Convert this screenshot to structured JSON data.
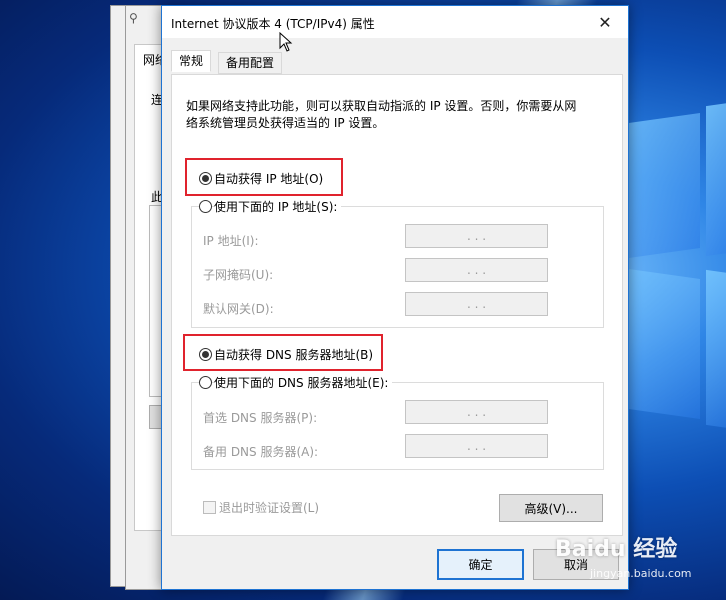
{
  "dialog": {
    "title": "Internet 协议版本 4 (TCP/IPv4) 属性",
    "tabs": [
      "常规",
      "备用配置"
    ],
    "description_line1": "如果网络支持此功能，则可以获取自动指派的 IP 设置。否则，你需要从网",
    "description_line2": "络系统管理员处获得适当的 IP 设置。",
    "ip": {
      "auto_label": "自动获得 IP 地址(O)",
      "manual_label": "使用下面的 IP 地址(S):",
      "fields": [
        {
          "label": "IP 地址(I):",
          "value": ".      .      ."
        },
        {
          "label": "子网掩码(U):",
          "value": ".      .      ."
        },
        {
          "label": "默认网关(D):",
          "value": ".      .      ."
        }
      ]
    },
    "dns": {
      "auto_label": "自动获得 DNS 服务器地址(B)",
      "manual_label": "使用下面的 DNS 服务器地址(E):",
      "fields": [
        {
          "label": "首选 DNS 服务器(P):",
          "value": ".      .      ."
        },
        {
          "label": "备用 DNS 服务器(A):",
          "value": ".      .      ."
        }
      ]
    },
    "validate_label": "退出时验证设置(L)",
    "advanced_label": "高级(V)...",
    "ok_label": "确定",
    "cancel_label": "取消",
    "selected": {
      "ip": "auto",
      "dns": "auto",
      "validate": false
    }
  },
  "background_window": {
    "tab_partial": "网络",
    "label1": "连",
    "label2": "此"
  },
  "watermark": {
    "brand": "Baidu 经验",
    "sub": "jingyan.baidu.com"
  },
  "colors": {
    "highlight_box": "#e0232d",
    "accent": "#1e73d2",
    "desktop": "#0d4fb5"
  }
}
